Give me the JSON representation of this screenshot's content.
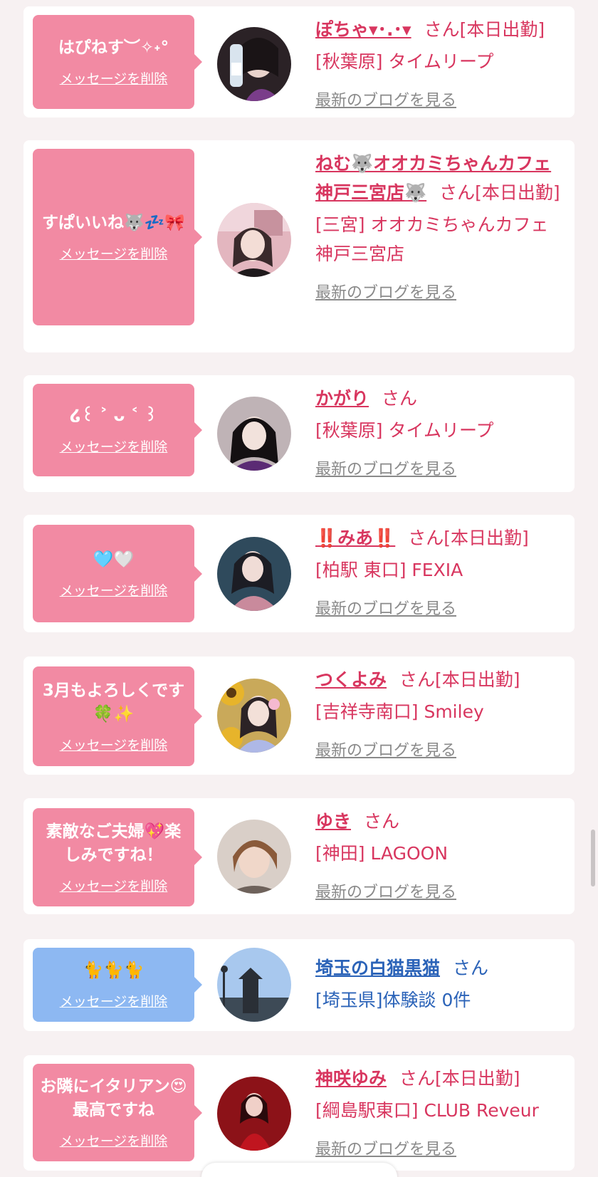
{
  "colors": {
    "pink": "#f28aa3",
    "blue": "#8db8f2",
    "accent": "#d8365f",
    "link_blue": "#2b63b8"
  },
  "delete_label": "メッセージを削除",
  "blog_label": "最新のブログを見る",
  "san_label": "さん",
  "items": [
    {
      "message": "はぴねす︶✧˖°",
      "name": "ぽちゃ▾･.･▾",
      "status": "[本日出勤]",
      "location": "[秋葉原] タイムリープ",
      "has_blog": true,
      "theme": "pink"
    },
    {
      "message": "すぱいいね🐺💤🎀",
      "name": "ねむ🐺オオカミちゃんカフェ神戸三宮店🐺",
      "status": "[本日出勤]",
      "location": "[三宮] オオカミちゃんカフェ神戸三宮店",
      "has_blog": true,
      "theme": "pink"
    },
    {
      "message": "໒꒰ ˃ ᴗ ˂ ꒱",
      "name": "かがり",
      "status": "",
      "location": "[秋葉原] タイムリープ",
      "has_blog": true,
      "theme": "pink"
    },
    {
      "message": "🩵🤍",
      "name": "‼️みあ‼️",
      "status": "[本日出勤]",
      "location": "[柏駅 東口] FEXIA",
      "has_blog": true,
      "theme": "pink"
    },
    {
      "message": "3月もよろしくです🍀✨",
      "name": "つくよみ",
      "status": "[本日出勤]",
      "location": "[吉祥寺南口] Smiley",
      "has_blog": true,
      "theme": "pink"
    },
    {
      "message": "素敵なご夫婦💖楽しみですね！",
      "name": "ゆき",
      "status": "",
      "location": "[神田] LAGOON",
      "has_blog": true,
      "theme": "pink"
    },
    {
      "message": "🐈🐈🐈",
      "name": "埼玉の白猫黒猫",
      "status": "",
      "location": "[埼玉県]体験談 0件",
      "has_blog": false,
      "theme": "blue"
    },
    {
      "message": "お隣にイタリアン😍最高ですね",
      "name": "神咲ゆみ",
      "status": "[本日出勤]",
      "location": "[綱島駅東口] CLUB Reveur",
      "has_blog": true,
      "theme": "pink"
    }
  ]
}
